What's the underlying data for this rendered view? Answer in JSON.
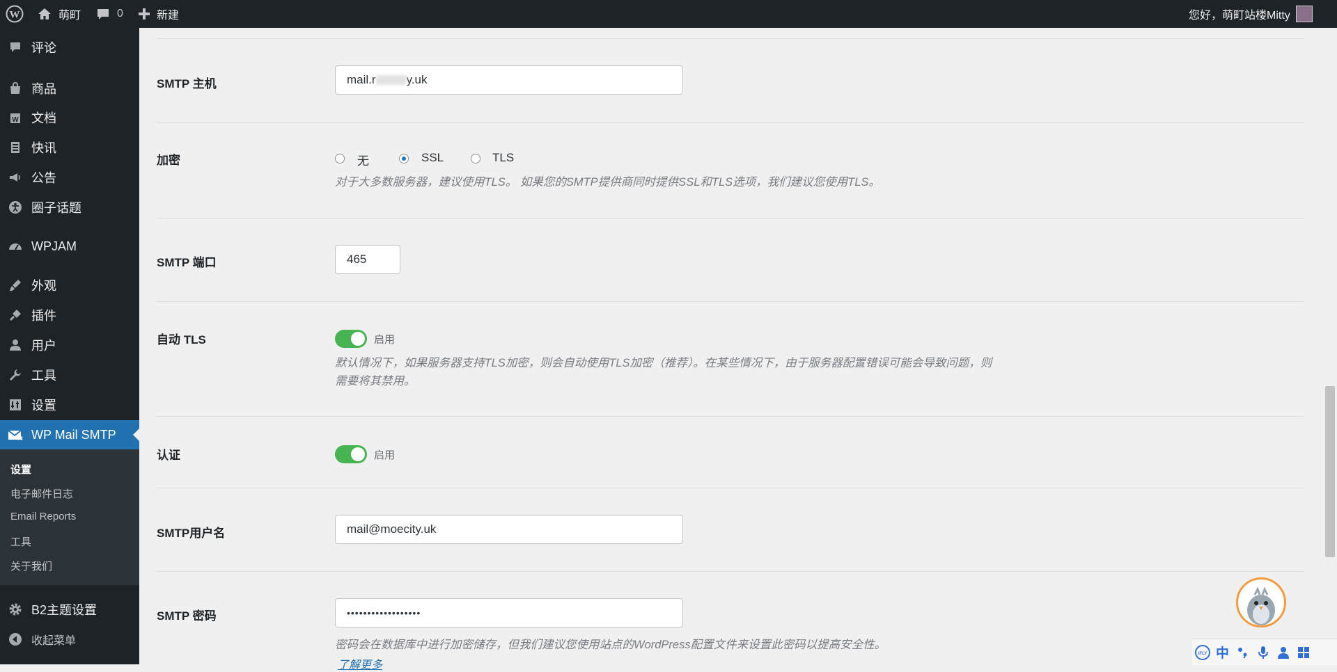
{
  "adminbar": {
    "site_name": "萌町",
    "comment_count": "0",
    "new_label": "新建",
    "greeting": "您好，萌町站楼Mitty"
  },
  "sidebar": {
    "items": [
      {
        "label": "评论",
        "icon": "comment-icon"
      },
      {
        "label": "商品",
        "icon": "shopping-bag-icon"
      },
      {
        "label": "文档",
        "icon": "document-icon"
      },
      {
        "label": "快讯",
        "icon": "news-icon"
      },
      {
        "label": "公告",
        "icon": "megaphone-icon"
      },
      {
        "label": "圈子话题",
        "icon": "universal-access-icon"
      },
      {
        "label": "WPJAM",
        "icon": "dashboard-icon"
      },
      {
        "label": "外观",
        "icon": "paintbrush-icon"
      },
      {
        "label": "插件",
        "icon": "plug-icon"
      },
      {
        "label": "用户",
        "icon": "user-icon"
      },
      {
        "label": "工具",
        "icon": "wrench-icon"
      },
      {
        "label": "设置",
        "icon": "settings-icon"
      },
      {
        "label": "WP Mail SMTP",
        "icon": "mail-icon"
      },
      {
        "label": "B2主题设置",
        "icon": "gear-icon"
      },
      {
        "label": "收起菜单",
        "icon": "collapse-icon"
      }
    ],
    "submenu": [
      "设置",
      "电子邮件日志",
      "Email Reports",
      "工具",
      "关于我们"
    ]
  },
  "form": {
    "smtp_host": {
      "label": "SMTP 主机",
      "value_prefix": "mail.r",
      "value_suffix": "y.uk"
    },
    "encryption": {
      "label": "加密",
      "options": [
        "无",
        "SSL",
        "TLS"
      ],
      "selected": "SSL",
      "description": "对于大多数服务器，建议使用TLS。 如果您的SMTP提供商同时提供SSL和TLS选项，我们建议您使用TLS。"
    },
    "smtp_port": {
      "label": "SMTP 端口",
      "value": "465"
    },
    "auto_tls": {
      "label": "自动 TLS",
      "toggle_label": "启用",
      "enabled": true,
      "description_line1": "默认情况下，如果服务器支持TLS加密，则会自动使用TLS加密（推荐）。在某些情况下，由于服务器配置错误可能会导致问题，则",
      "description_line2": "需要将其禁用。"
    },
    "auth": {
      "label": "认证",
      "toggle_label": "启用",
      "enabled": true
    },
    "smtp_username": {
      "label": "SMTP用户名",
      "value": "mail@moecity.uk"
    },
    "smtp_password": {
      "label": "SMTP 密码",
      "value": "••••••••••••••••••",
      "description": "密码会在数据库中进行加密储存，但我们建议您使用站点的WordPress配置文件来设置此密码以提高安全性。",
      "learn_more": "了解更多"
    }
  },
  "ime": {
    "lang": "中"
  }
}
